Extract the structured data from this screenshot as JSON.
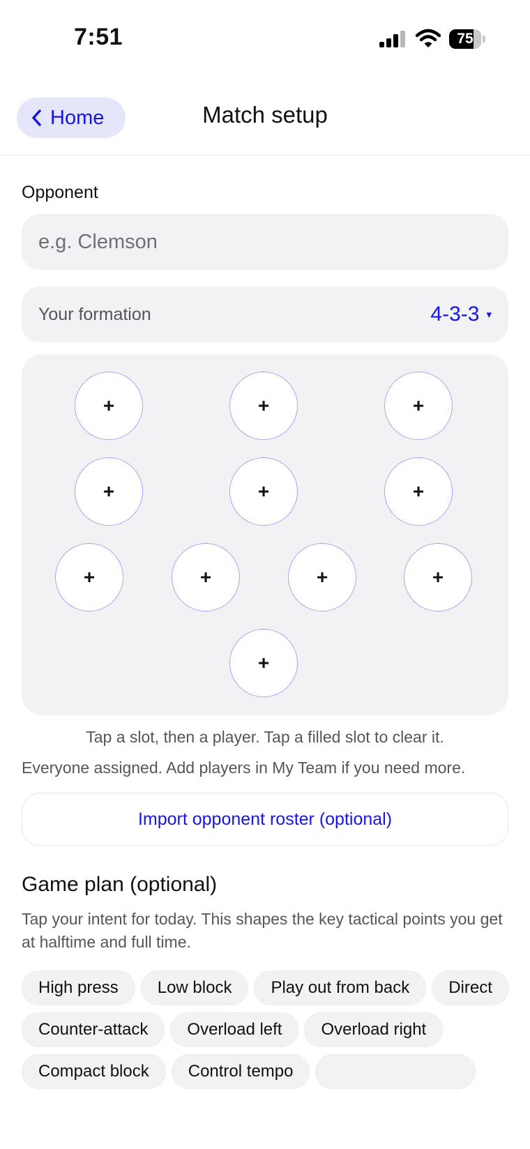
{
  "status_bar": {
    "time": "7:51",
    "battery": "75",
    "battery_level": 0.75
  },
  "nav": {
    "back_label": "Home",
    "title": "Match setup"
  },
  "opponent": {
    "label": "Opponent",
    "placeholder": "e.g. Clemson",
    "value": ""
  },
  "formation": {
    "label": "Your formation",
    "value": "4-3-3",
    "caret": "▾"
  },
  "pitch": {
    "slot_symbol": "+"
  },
  "hints": {
    "tap": "Tap a slot, then a player. Tap a filled slot to clear it.",
    "assigned": "Everyone assigned. Add players in My Team if you need more."
  },
  "import_label": "Import opponent roster (optional)",
  "game_plan": {
    "title": "Game plan (optional)",
    "description": "Tap your intent for today. This shapes the key tactical points you get at halftime and full time.",
    "chips": [
      "High press",
      "Low block",
      "Play out from back",
      "Direct",
      "Counter-attack",
      "Overload left",
      "Overload right",
      "Compact block",
      "Control tempo",
      ""
    ]
  },
  "colors": {
    "accent": "#1515e6",
    "accent_bg": "#e6e6fb",
    "field_bg": "#f2f2f4",
    "secondary_text": "#55555b"
  }
}
